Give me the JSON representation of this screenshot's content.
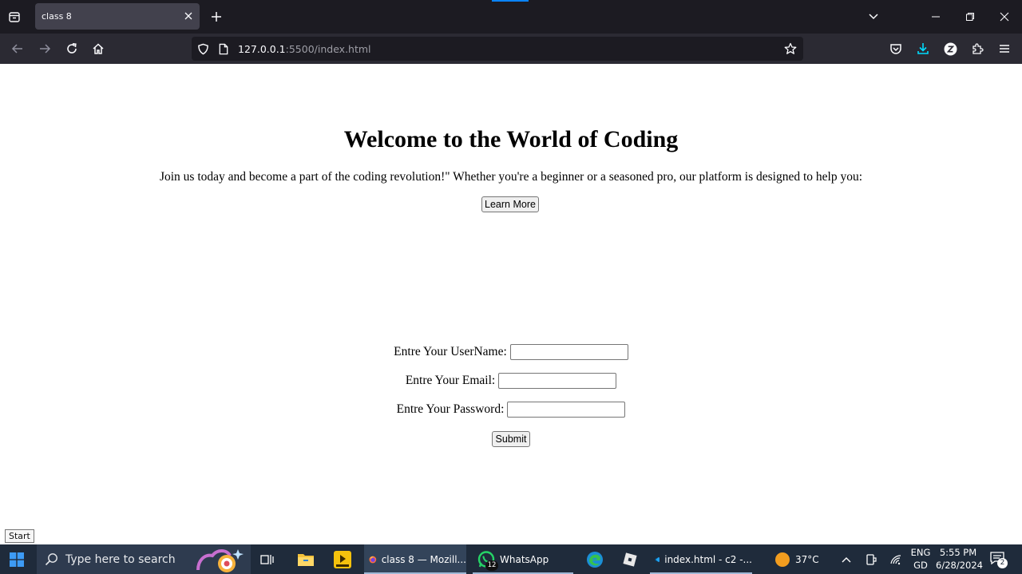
{
  "browser": {
    "tab": {
      "title": "class 8"
    },
    "url": {
      "host": "127.0.0.1",
      "path": ":5500/index.html"
    }
  },
  "page": {
    "heading": "Welcome to the World of Coding",
    "intro": "Join us today and become a part of the coding revolution!\" Whether you're a beginner or a seasoned pro, our platform is designed to help you:",
    "learn_more": "Learn More",
    "form": {
      "username_label": "Entre Your UserName:",
      "email_label": "Entre Your Email:",
      "password_label": "Entre Your Password:",
      "username_value": "",
      "email_value": "",
      "password_value": "",
      "submit": "Submit"
    },
    "start_tooltip": "Start"
  },
  "taskbar": {
    "search_placeholder": "Type here to search",
    "apps": [
      {
        "label": "class 8 — Mozill...",
        "icon": "firefox-icon"
      },
      {
        "label": "WhatsApp",
        "icon": "whatsapp-icon",
        "badge": "12"
      },
      {
        "label": "index.html - c2 -...",
        "icon": "vscode-icon"
      }
    ],
    "weather": "37°C",
    "lang_top": "ENG",
    "lang_bottom": "GD",
    "time": "5:55 PM",
    "date": "6/28/2024",
    "notifications": "2"
  },
  "colors": {
    "tabstrip": "#1c1b22",
    "navbar": "#2b2a33",
    "urlbar": "#1c1b22",
    "taskbar": "#1f2b3b",
    "download_accent": "#00ddff"
  }
}
